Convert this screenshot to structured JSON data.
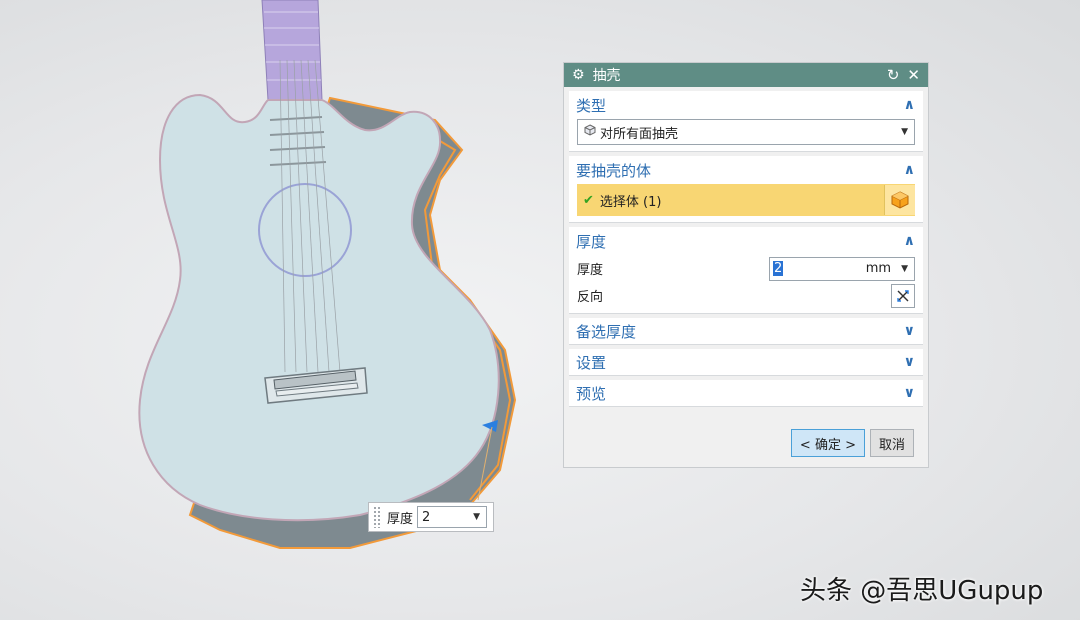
{
  "dialog": {
    "title": "抽壳",
    "reset_icon": "reset-icon",
    "close_icon": "close-icon",
    "type_section": {
      "label": "类型",
      "selected": "对所有面抽壳",
      "icon": "shell-type-icon"
    },
    "body_section": {
      "label": "要抽壳的体",
      "select_label": "选择体 (1)",
      "icon": "solid-body-icon"
    },
    "thickness_section": {
      "label": "厚度",
      "field_label": "厚度",
      "value": "2",
      "unit": "mm",
      "reverse_label": "反向"
    },
    "collapsed_sections": [
      "备选厚度",
      "设置",
      "预览"
    ],
    "ok_button": "< 确定 >",
    "cancel_button": "取消"
  },
  "onscreen_input": {
    "label": "厚度",
    "value": "2"
  },
  "watermark": "头条 @吾思UGupup",
  "colors": {
    "titlebar": "#5f8d85",
    "section_label": "#2f6fb2",
    "selection_highlight": "#f8d673",
    "edge_highlight": "#f29a3a",
    "body_face": "#cfe1e6",
    "fretboard": "#b6a6dc"
  }
}
